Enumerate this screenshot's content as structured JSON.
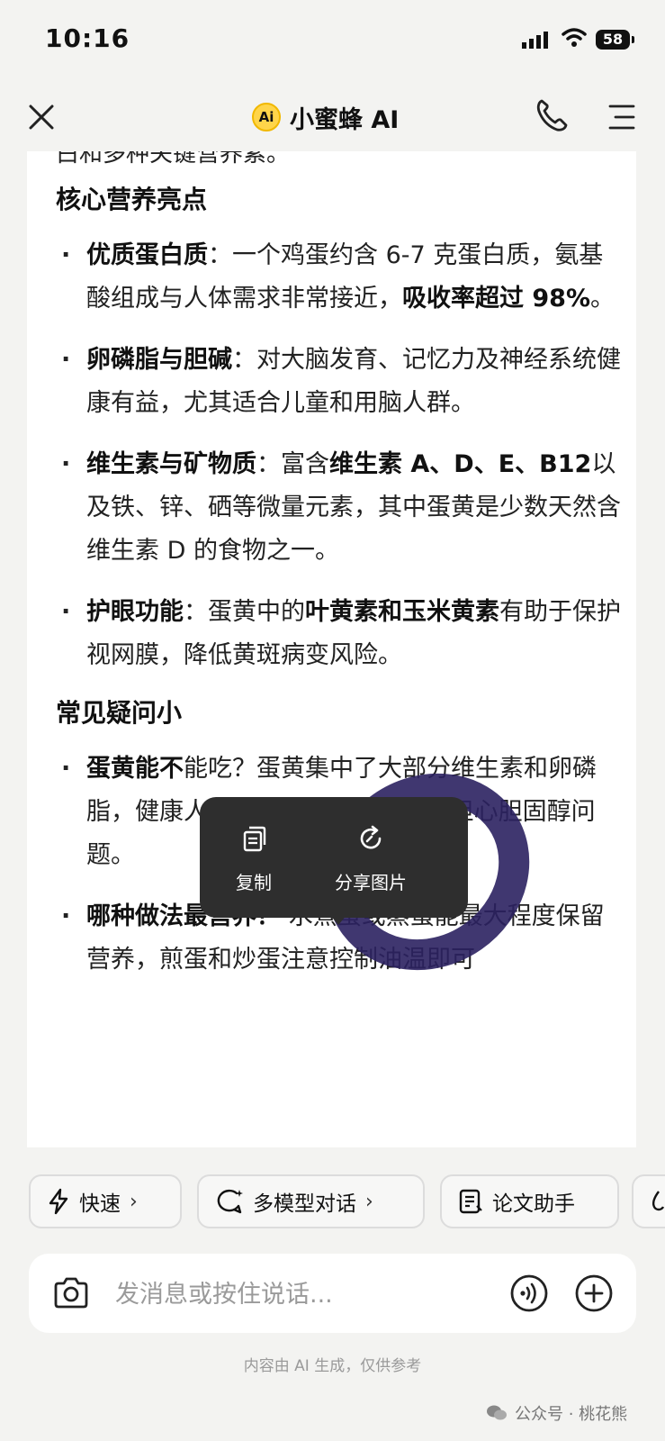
{
  "status_bar": {
    "time": "10:16",
    "battery": "58"
  },
  "header": {
    "title": "小蜜蜂 AI",
    "logo_text": "Ai"
  },
  "content": {
    "cut_line": "白和多种关键营养素。",
    "section1_title": "核心营养亮点",
    "items1": [
      {
        "bold": "优质蛋白质",
        "text": "：一个鸡蛋约含 6-7 克蛋白质，氨基酸组成与人体需求非常接近，",
        "bold2": "吸收率超过 98%",
        "text2": "。"
      },
      {
        "bold": "卵磷脂与胆碱",
        "text": "：对大脑发育、记忆力及神经系统健康有益，尤其适合儿童和用脑人群。"
      },
      {
        "bold": "维生素与矿物质",
        "text": "：富含",
        "bold2": "维生素 A、D、E、B12",
        "text2": "以及铁、锌、硒等微量元素，其中蛋黄是少数天然含维生素 D 的食物之一。"
      },
      {
        "bold": "护眼功能",
        "text": "：蛋黄中的",
        "bold2": "叶黄素和玉米黄素",
        "text2": "有助于保护视网膜，降低黄斑病变风险。"
      }
    ],
    "section2_title": "常见疑问小",
    "items2": [
      {
        "bold": "蛋黄能不",
        "text": "能吃？蛋黄集中了大部分维生素和卵磷脂，健康人群每日1-2 个全蛋无需担心胆固醇问题。"
      },
      {
        "bold": "哪种做法最营养？",
        "text": " 水煮蛋或蒸蛋能最大程度保留营养，煎蛋和炒蛋注意控制油温即可"
      }
    ]
  },
  "popup": {
    "copy_label": "复制",
    "share_label": "分享图片"
  },
  "chips": [
    {
      "label": "快速",
      "icon": "lightning-icon"
    },
    {
      "label": "多模型对话",
      "icon": "chat-sparkle-icon"
    },
    {
      "label": "论文助手",
      "icon": "document-icon"
    }
  ],
  "input": {
    "placeholder": "发消息或按住说话..."
  },
  "disclaimer": "内容由 AI 生成，仅供参考",
  "watermark": "公众号 · 桃花熊",
  "colors": {
    "ring": "#2b2160",
    "popup": "#2e2e2e",
    "logo": "#ffd54a"
  }
}
